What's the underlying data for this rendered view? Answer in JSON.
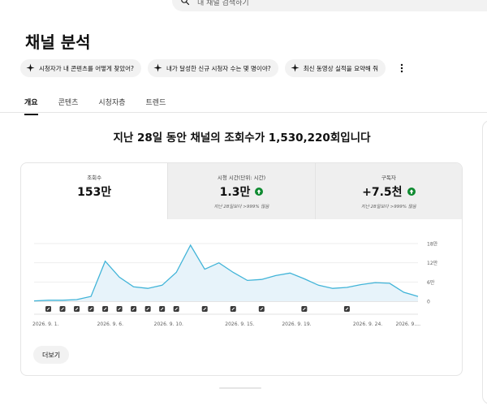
{
  "search": {
    "placeholder": "내 채널 검색하기",
    "icon": "search-icon"
  },
  "page_title": "채널 분석",
  "suggestions": [
    {
      "label": "시청자가 내 콘텐츠를 어떻게 찾았어?",
      "icon": "sparkle-icon"
    },
    {
      "label": "내가 달성한 신규 시청자 수는 몇 명이야?",
      "icon": "sparkle-icon"
    },
    {
      "label": "최신 동영상 실적을 요약해 줘",
      "icon": "sparkle-icon"
    }
  ],
  "tabs": [
    {
      "label": "개요",
      "active": true
    },
    {
      "label": "콘텐츠",
      "active": false
    },
    {
      "label": "시청자층",
      "active": false
    },
    {
      "label": "트렌드",
      "active": false
    }
  ],
  "headline": "지난 28일 동안 채널의 조회수가 1,530,220회입니다",
  "metrics": [
    {
      "label": "조회수",
      "value": "153만",
      "sub": "",
      "arrow": false
    },
    {
      "label": "시청 시간(단위: 시간)",
      "value": "1.3만",
      "sub": "지난 28일보다 >999% 많음",
      "arrow": true
    },
    {
      "label": "구독자",
      "value": "+7.5천",
      "sub": "지난 28일보다 >999% 많음",
      "arrow": true
    }
  ],
  "more_button": "더보기",
  "colors": {
    "accent": "#41b4d8",
    "fill": "#e7f3fa",
    "up_green": "#0e8a30"
  },
  "chart_data": {
    "type": "area",
    "series": [
      {
        "values": [
          0.1,
          0.3,
          0.3,
          0.5,
          1.5,
          12.5,
          7.5,
          4.5,
          4,
          5,
          9,
          17.5,
          10,
          12,
          9,
          6.5,
          6.8,
          8,
          8.8,
          7,
          5,
          4,
          4.3,
          5.2,
          5.8,
          5.6,
          2.8,
          1.5
        ]
      }
    ],
    "x_tick_labels": [
      "2026. 9. 1.",
      "2026. 9. 6.",
      "2026. 9. 10.",
      "2026. 9. 15.",
      "2026. 9. 19.",
      "2026. 9. 24.",
      "2026. 9...."
    ],
    "x_tick_index": [
      0,
      5,
      9,
      14,
      18,
      23,
      26
    ],
    "y_tick_labels": [
      "0",
      "6만",
      "12만",
      "18만"
    ],
    "ylim": [
      0,
      20
    ],
    "upload_markers_index": [
      1,
      2,
      3,
      4,
      5,
      6,
      7,
      8,
      9,
      10,
      12,
      14,
      16,
      19,
      22
    ],
    "grid": true
  }
}
